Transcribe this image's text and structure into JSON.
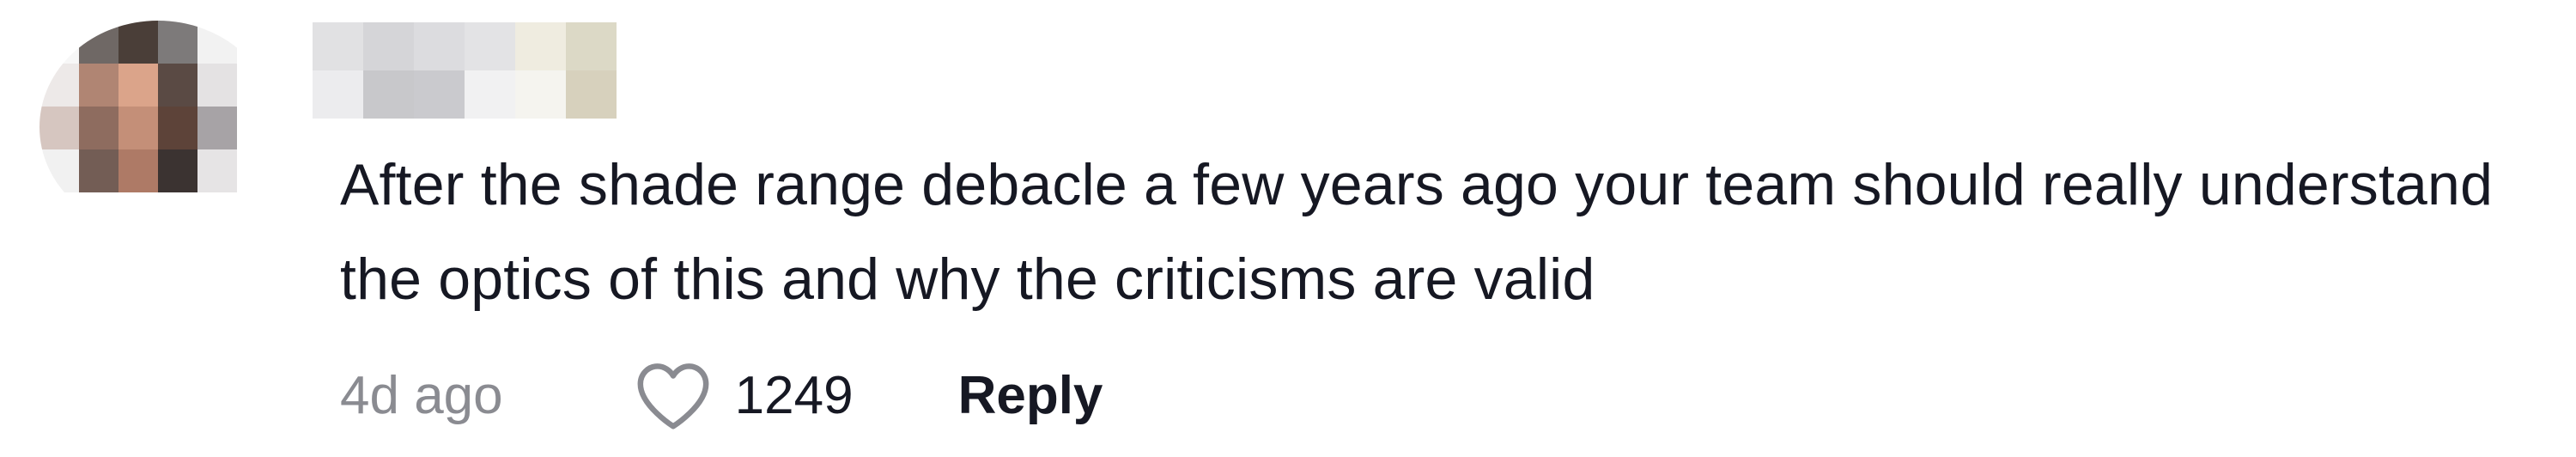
{
  "comment": {
    "text": "After the shade range debacle a few years ago your team should really understand the optics of this and why the criticisms are valid",
    "timestamp": "4d ago",
    "like_count": "1249",
    "reply_label": "Reply",
    "like_icon": "heart-outline-icon"
  },
  "colors": {
    "text_primary": "#161823",
    "text_secondary": "#8a8b91",
    "background": "#ffffff"
  }
}
